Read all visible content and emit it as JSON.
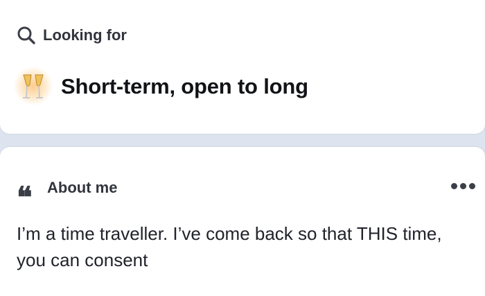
{
  "looking_for": {
    "header_label": "Looking for",
    "header_icon": "search-icon",
    "goal_icon": "champagne-glasses-icon",
    "goal_text": "Short-term, open to long"
  },
  "about_me": {
    "header_label": "About me",
    "header_icon": "quote-icon",
    "menu_icon": "more-options-icon",
    "bio": "I’m a time traveller. I’ve come back so that THIS time, you can consent"
  },
  "colors": {
    "background": "#dde4ef",
    "card": "#ffffff",
    "header_text": "#30343c",
    "body_text": "#20232a"
  }
}
